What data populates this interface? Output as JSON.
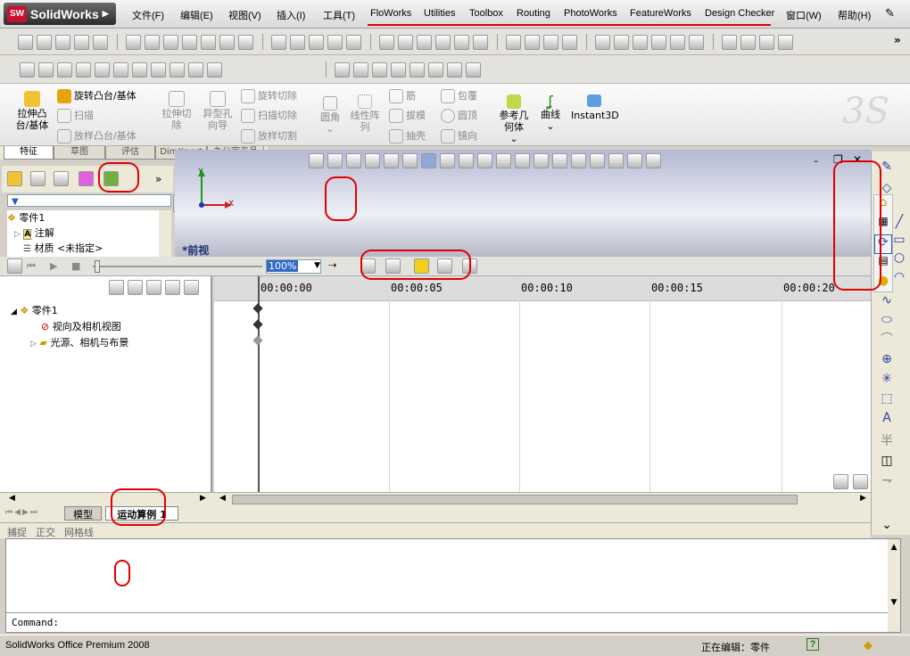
{
  "app": {
    "logo_text": "SolidWorks",
    "logo_badge": "SW",
    "logo_arrow": "▶"
  },
  "menu": [
    "文件(F)",
    "编辑(E)",
    "视图(V)",
    "插入(I)",
    "工具(T)",
    "FloWorks",
    "Utilities",
    "Toolbox",
    "Routing",
    "PhotoWorks",
    "FeatureWorks",
    "Design Checker",
    "窗口(W)",
    "帮助(H)"
  ],
  "command_manager": {
    "extrude": "拉伸凸\n台/基体",
    "revolve": "旋转凸台/基体",
    "sweep": "扫描",
    "loft": "放样凸台/基体",
    "extrude_cut": "拉伸切\n除",
    "hole_wizard": "异型孔\n向导",
    "revolve_cut": "旋转切除",
    "sweep_cut": "扫描切除",
    "loft_cut": "放样切割",
    "fillet": "圆角",
    "linear_pattern": "线性阵\n列",
    "rib": "筋",
    "draft": "拔模",
    "shell": "抽壳",
    "wrap": "包覆",
    "dome": "圆顶",
    "mirror": "镜向",
    "ref_geometry": "参考几\n何体",
    "curves": "曲线",
    "instant3d": "Instant3D"
  },
  "tabs": [
    "特征",
    "草图",
    "评估",
    "DimXpert",
    "办公室产品"
  ],
  "feature_tree": {
    "root": "零件1",
    "items": [
      "注解",
      "材质 <未指定>"
    ]
  },
  "viewport": {
    "view_label": "*前视",
    "axis_x": "X",
    "axis_y": "Y"
  },
  "motion": {
    "zoom_value": "100%",
    "tree_root": "零件1",
    "tree_items": [
      "视向及相机视图",
      "光源、相机与布景"
    ]
  },
  "timeline_ticks": [
    "00:00:00",
    "00:00:05",
    "00:00:10",
    "00:00:15",
    "00:00:20"
  ],
  "bottom_tabs": [
    "模型",
    "运动算例 1"
  ],
  "snap_bar": [
    "捕捉",
    "正交",
    "网格线"
  ],
  "command_prompt": "Command:",
  "status": {
    "product": "SolidWorks Office Premium 2008",
    "editing": "正在编辑：零件",
    "help": "?"
  }
}
